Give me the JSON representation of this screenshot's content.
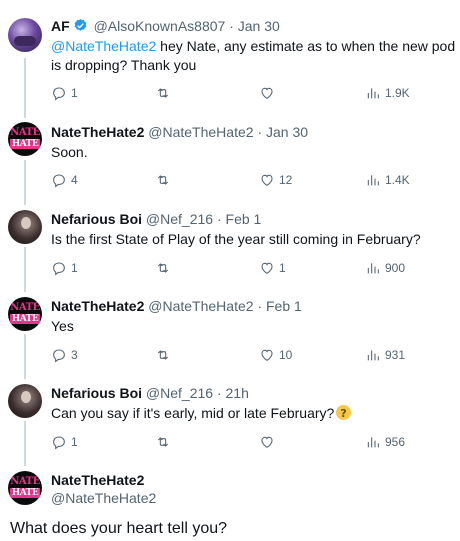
{
  "tweets": [
    {
      "name": "AF",
      "handle": "@AlsoKnownAs8807",
      "time": "Jan 30",
      "verified": true,
      "mention": "@NateTheHate2",
      "text": " hey Nate, any estimate as to when the new pod is dropping? Thank you",
      "replies": "1",
      "retweets": "",
      "likes": "",
      "views": "1.9K"
    },
    {
      "name": "NateTheHate2",
      "handle": "@NateTheHate2",
      "time": "Jan 30",
      "text": "Soon.",
      "replies": "4",
      "retweets": "",
      "likes": "12",
      "views": "1.4K"
    },
    {
      "name": "Nefarious Boi",
      "handle": "@Nef_216",
      "time": "Feb 1",
      "text": "Is the first State of Play of the year still coming in February?",
      "replies": "1",
      "retweets": "",
      "likes": "1",
      "views": "900"
    },
    {
      "name": "NateTheHate2",
      "handle": "@NateTheHate2",
      "time": "Feb 1",
      "text": "Yes",
      "replies": "3",
      "retweets": "",
      "likes": "10",
      "views": "931"
    },
    {
      "name": "Nefarious Boi",
      "handle": "@Nef_216",
      "time": "21h",
      "text": "Can you say if it's early, mid or late February?",
      "replies": "1",
      "retweets": "",
      "likes": "",
      "views": "956"
    }
  ],
  "main": {
    "name": "NateTheHate2",
    "handle": "@NateTheHate2",
    "text": "What does your heart tell you?"
  },
  "avatar_art": {
    "nth_top": "NATE",
    "nth_bottom": "HATE"
  },
  "separator": "·",
  "colors": {
    "link": "#1d9bf0",
    "verified": "#1d9bf0",
    "accent": "#e8338a",
    "muted": "#536471"
  },
  "icons": [
    "reply-icon",
    "retweet-icon",
    "like-icon",
    "views-icon",
    "verified-badge-icon",
    "thinking-emoji-icon"
  ]
}
